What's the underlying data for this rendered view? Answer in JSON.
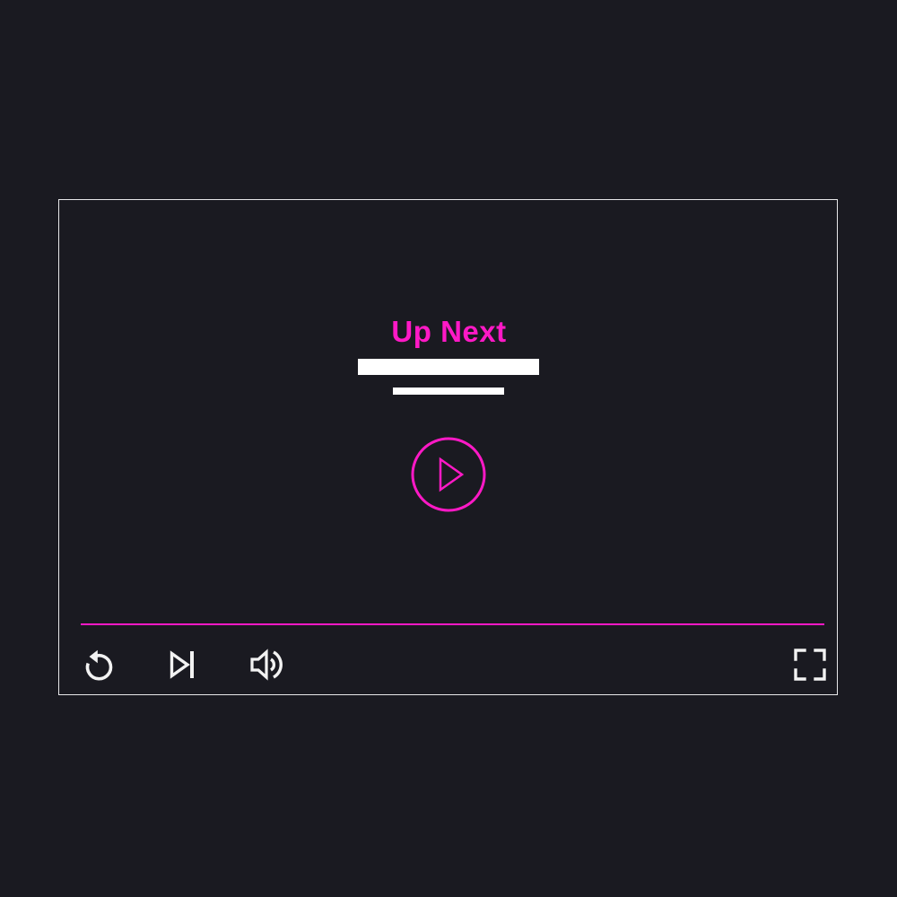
{
  "colors": {
    "accent": "#ff19c6",
    "icon": "#f2f2f2",
    "background": "#1a1a21",
    "frame": "#e8e8ea"
  },
  "up_next": {
    "title": "Up Next"
  },
  "progress": {
    "value": 1.0
  },
  "controls": {
    "replay_icon": "replay-icon",
    "skip_next_icon": "skip-next-icon",
    "volume_icon": "volume-icon",
    "fullscreen_icon": "fullscreen-icon",
    "play_icon": "play-circle-icon"
  }
}
